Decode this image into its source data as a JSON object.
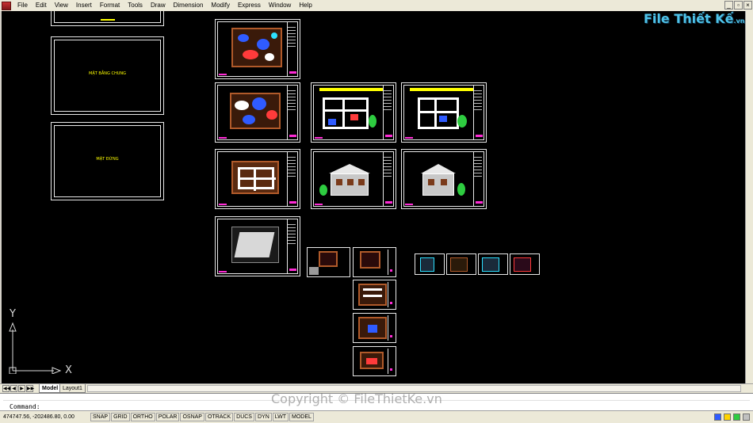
{
  "menu": {
    "items": [
      "File",
      "Edit",
      "View",
      "Insert",
      "Format",
      "Tools",
      "Draw",
      "Dimension",
      "Modify",
      "Express",
      "Window",
      "Help"
    ]
  },
  "window_controls": {
    "minimize": "_",
    "restore": "▫",
    "close": "×"
  },
  "logo": {
    "text": "File Thiết Kế",
    "suffix": ".vn"
  },
  "canvas": {
    "background": "#000000",
    "blank_sheets": [
      {
        "label": ""
      },
      {
        "label": "MẶT BẰNG CHUNG"
      },
      {
        "label": "MẶT ĐỨNG"
      }
    ]
  },
  "ucs": {
    "y_label": "Y",
    "x_label": "X"
  },
  "tabs": {
    "nav": [
      "◀◀",
      "◀",
      "▶",
      "▶▶"
    ],
    "model": "Model",
    "layout1": "Layout1"
  },
  "command": {
    "prompt": "Command:",
    "watermark": "Copyright © FileThietKe.vn"
  },
  "status": {
    "coords": "474747.56, -202486.80, 0.00",
    "toggles": [
      "SNAP",
      "GRID",
      "ORTHO",
      "POLAR",
      "OSNAP",
      "OTRACK",
      "DUCS",
      "DYN",
      "LWT",
      "MODEL"
    ]
  },
  "colors": {
    "accent_magenta": "#ff2bd6",
    "cad_yellow": "#ffff00",
    "cad_red": "#ff3b3b",
    "cad_blue": "#2f5bff",
    "cad_cyan": "#2de0ff",
    "cad_green": "#2ecc40"
  }
}
